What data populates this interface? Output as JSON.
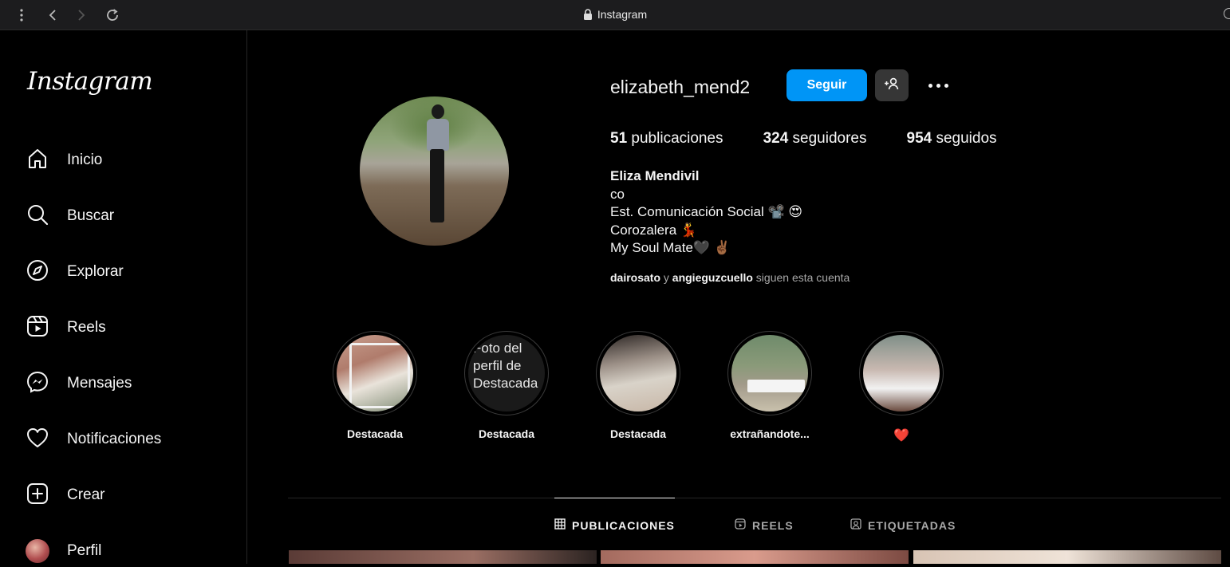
{
  "browser": {
    "title": "Instagram"
  },
  "sidebar": {
    "logo": "Instagram",
    "items": [
      {
        "label": "Inicio",
        "icon": "home-icon"
      },
      {
        "label": "Buscar",
        "icon": "search-icon"
      },
      {
        "label": "Explorar",
        "icon": "compass-icon"
      },
      {
        "label": "Reels",
        "icon": "reels-icon"
      },
      {
        "label": "Mensajes",
        "icon": "messenger-icon"
      },
      {
        "label": "Notificaciones",
        "icon": "heart-icon"
      },
      {
        "label": "Crear",
        "icon": "plus-square-icon"
      },
      {
        "label": "Perfil",
        "icon": "avatar"
      }
    ]
  },
  "profile": {
    "username": "elizabeth_mend2",
    "follow_label": "Seguir",
    "stats": {
      "posts": "51",
      "posts_label": " publicaciones",
      "followers": "324",
      "followers_label": " seguidores",
      "following": "954",
      "following_label": " seguidos"
    },
    "bio": {
      "name": "Eliza Mendivil",
      "lines": [
        "co",
        "Est. Comunicación Social 📽️ 😍",
        "Corozalera 💃",
        "My Soul Mate🖤 ✌🏾"
      ]
    },
    "followed_by": {
      "user1": "dairosato",
      "joiner": " y ",
      "user2": "angieguzcuello",
      "suffix": " siguen esta cuenta"
    }
  },
  "highlights": [
    {
      "label": "Destacada"
    },
    {
      "label": "Destacada",
      "alt_text": "Foto del perfil de Destacada"
    },
    {
      "label": "Destacada"
    },
    {
      "label": "extrañandote..."
    },
    {
      "label": "❤️"
    }
  ],
  "tabs": [
    {
      "label": "PUBLICACIONES",
      "icon": "grid-icon",
      "active": true
    },
    {
      "label": "REELS",
      "icon": "reels-icon",
      "active": false
    },
    {
      "label": "ETIQUETADAS",
      "icon": "tagged-icon",
      "active": false
    }
  ],
  "colors": {
    "accent": "#0095f6",
    "background": "#000000",
    "heart": "#ed4956"
  }
}
